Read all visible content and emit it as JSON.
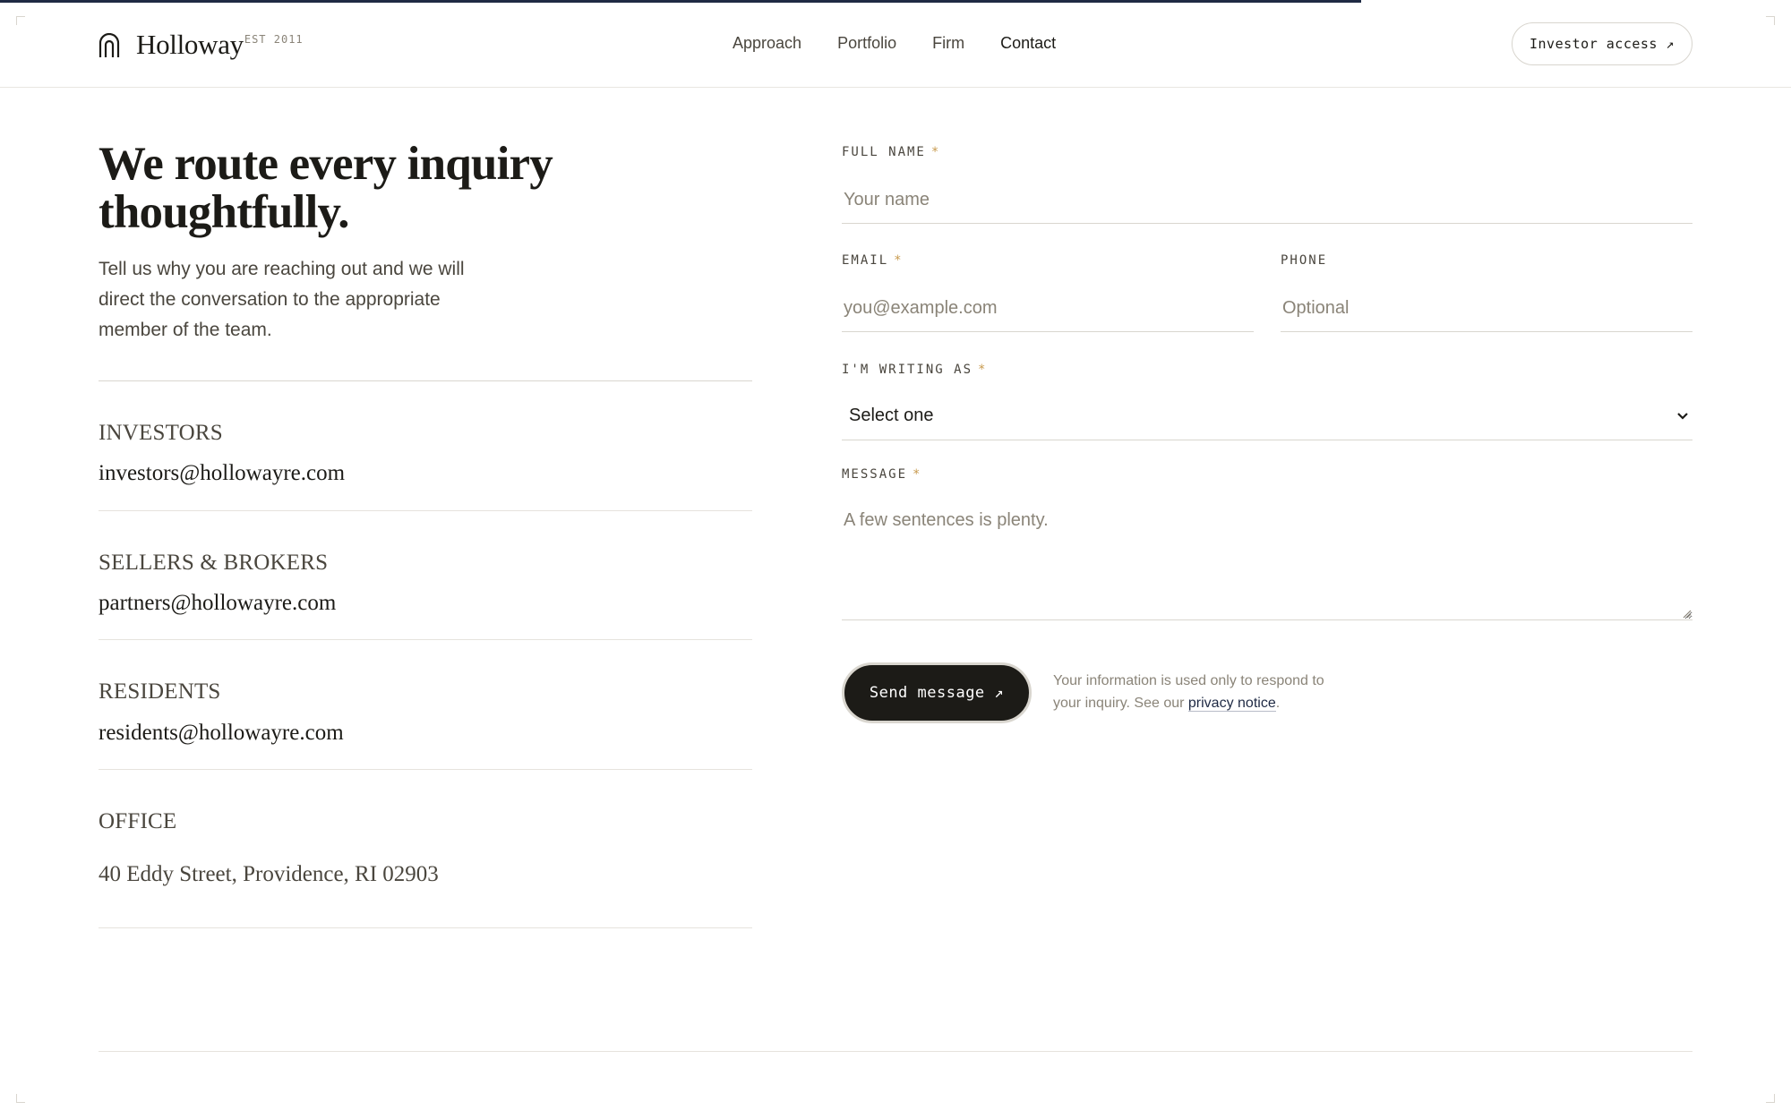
{
  "header": {
    "brand": "Holloway",
    "est": "EST 2011",
    "nav": [
      {
        "label": "Approach"
      },
      {
        "label": "Portfolio"
      },
      {
        "label": "Firm"
      },
      {
        "label": "Contact"
      }
    ],
    "investor_button": "Investor access ↗"
  },
  "scroll_progress": 0.76,
  "intro": {
    "headline": "We route every inquiry thoughtfully.",
    "body": "Tell us why you are reaching out and we will direct the conversation to the appropriate member of the team."
  },
  "contacts": [
    {
      "label": "INVESTORS",
      "value": "investors@hollowayre.com"
    },
    {
      "label": "SELLERS & BROKERS",
      "value": "partners@hollowayre.com"
    },
    {
      "label": "RESIDENTS",
      "value": "residents@hollowayre.com"
    },
    {
      "label": "OFFICE",
      "value": "40 Eddy Street, Providence, RI 02903"
    }
  ],
  "form": {
    "full_name": {
      "label": "FULL NAME",
      "required": "*",
      "placeholder": "Your name"
    },
    "email": {
      "label": "EMAIL",
      "required": "*",
      "placeholder": "you@example.com"
    },
    "phone": {
      "label": "PHONE",
      "placeholder": "Optional"
    },
    "writing_as": {
      "label": "I'M WRITING AS",
      "required": "*",
      "selected": "Select one"
    },
    "message": {
      "label": "MESSAGE",
      "required": "*",
      "placeholder": "A few sentences is plenty."
    },
    "submit": "Send message ↗",
    "privacy_text": "Your information is used only to respond to your inquiry. See our ",
    "privacy_link": "privacy notice",
    "privacy_end": "."
  },
  "colors": {
    "accent": "#1f2a44",
    "required": "#c89a4e",
    "ink": "#1c1b17",
    "muted": "#8a8478"
  }
}
